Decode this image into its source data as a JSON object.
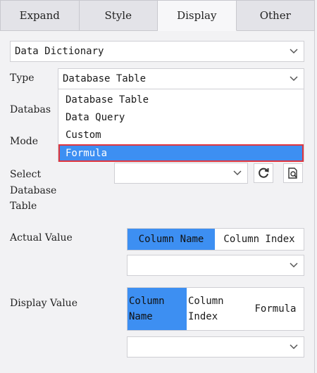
{
  "tabs": [
    {
      "label": "Expand"
    },
    {
      "label": "Style"
    },
    {
      "label": "Display"
    },
    {
      "label": "Other"
    }
  ],
  "active_tab": "Display",
  "dictionary_select": {
    "value": "Data Dictionary"
  },
  "type_field": {
    "label": "Type",
    "value": "Database Table"
  },
  "database_field": {
    "label": "Databas"
  },
  "mode_field": {
    "label": "Mode"
  },
  "type_dropdown": {
    "options": [
      "Database Table",
      "Data Query",
      "Custom",
      "Formula"
    ],
    "selected": "Formula"
  },
  "select_table": {
    "label_lines": [
      "Select",
      "Database",
      "Table"
    ],
    "value": ""
  },
  "actual_value": {
    "label": "Actual Value",
    "options": [
      "Column Name",
      "Column Index"
    ],
    "selected": "Column Name",
    "select_value": ""
  },
  "display_value": {
    "label": "Display Value",
    "option1_lines": [
      "Column",
      "Name"
    ],
    "option2_lines": [
      "Column",
      "Index"
    ],
    "option3": "Formula",
    "selected": "Column Name",
    "select_value": ""
  },
  "colors": {
    "accent": "#3d8ff2",
    "highlight_border": "#e0353e"
  }
}
